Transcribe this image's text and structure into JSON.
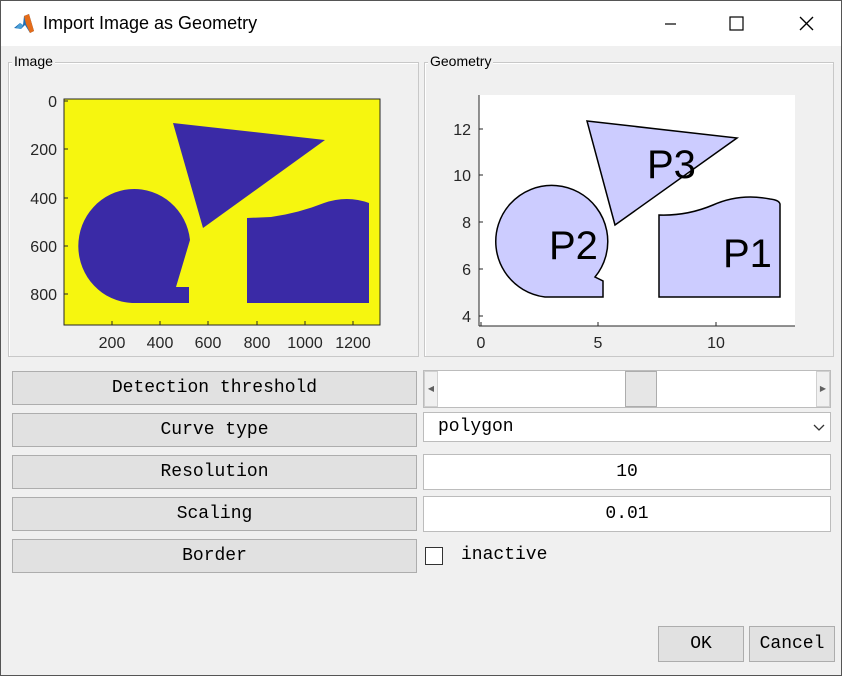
{
  "window": {
    "title": "Import Image as Geometry",
    "icons": [
      "matlab-logo-icon",
      "minimize-icon",
      "maximize-icon",
      "close-icon"
    ]
  },
  "image_panel": {
    "title": "Image",
    "x_ticks": [
      "200",
      "400",
      "600",
      "800",
      "1000",
      "1200"
    ],
    "y_ticks": [
      "0",
      "200",
      "400",
      "600",
      "800"
    ],
    "colors": {
      "background": "#f6f60f",
      "shapes": "#3a2aa6"
    }
  },
  "geometry_panel": {
    "title": "Geometry",
    "x_ticks": [
      "0",
      "5",
      "10"
    ],
    "y_ticks": [
      "4",
      "6",
      "8",
      "10",
      "12"
    ],
    "polygon_labels": [
      "P1",
      "P2",
      "P3"
    ],
    "colors": {
      "fill": "#ccccff",
      "edge": "#000000"
    }
  },
  "controls": {
    "detection_threshold_label": "Detection threshold",
    "curve_type_label": "Curve type",
    "curve_type_value": "polygon",
    "resolution_label": "Resolution",
    "resolution_value": "10",
    "scaling_label": "Scaling",
    "scaling_value": "0.01",
    "border_label": "Border",
    "border_checkbox_label": "inactive",
    "border_checked": false,
    "threshold_fraction": 0.5
  },
  "buttons": {
    "ok": "OK",
    "cancel": "Cancel"
  }
}
